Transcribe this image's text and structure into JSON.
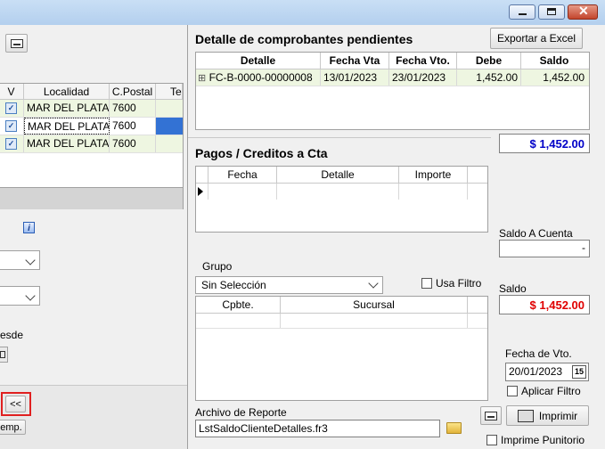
{
  "left_panel": {
    "customers_grid": {
      "columns": [
        "V",
        "Localidad",
        "C.Postal",
        "Te"
      ],
      "rows": [
        {
          "checked": true,
          "localidad": "MAR DEL PLATA",
          "cpostal": "7600",
          "selected": false
        },
        {
          "checked": true,
          "localidad": "MAR DEL PLATA",
          "cpostal": "7600",
          "selected": true
        },
        {
          "checked": true,
          "localidad": "MAR DEL PLATA",
          "cpostal": "7600",
          "selected": false
        }
      ]
    },
    "info_icon": "i",
    "desde_label": "esde",
    "collapse_button": "<<",
    "temp_button": "emp."
  },
  "right_panel": {
    "title": "Detalle de comprobantes pendientes",
    "export_button": "Exportar a Excel",
    "details_grid": {
      "columns": [
        "Detalle",
        "Fecha Vta",
        "Fecha Vto.",
        "Debe",
        "Saldo"
      ],
      "rows": [
        {
          "expand": "⊞",
          "detalle": "FC-B-0000-00000008",
          "fecha_vta": "13/01/2023",
          "fecha_vto": "23/01/2023",
          "debe": "1,452.00",
          "saldo": "1,452.00"
        }
      ]
    },
    "total_top": "$ 1,452.00",
    "payments_title": "Pagos / Creditos a Cta",
    "payments_grid": {
      "columns": [
        "Fecha",
        "Detalle",
        "Importe"
      ]
    },
    "saldo_a_cuenta_label": "Saldo A Cuenta",
    "saldo_a_cuenta_value": "-",
    "grupo_label": "Grupo",
    "grupo_value": "Sin Selección",
    "usa_filtro_label": "Usa Filtro",
    "cbte_grid": {
      "columns": [
        "Cpbte.",
        "Sucursal"
      ]
    },
    "saldo_label": "Saldo",
    "saldo_value": "$ 1,452.00",
    "fecha_vto_label": "Fecha de Vto.",
    "fecha_vto_value": "20/01/2023",
    "calendar_glyph": "15",
    "aplicar_filtro_label": "Aplicar Filtro",
    "archivo_label": "Archivo de Reporte",
    "archivo_value": "LstSaldoClienteDetalles.fr3",
    "imprimir_button": "Imprimir",
    "imprime_puntorio_label": "Imprime Punitorio"
  },
  "colors": {
    "total_top": "#0000c8",
    "saldo_red": "#e00000",
    "selection": "#3372d4",
    "row_green": "#eef6e1",
    "highlight_border": "#e02020"
  }
}
